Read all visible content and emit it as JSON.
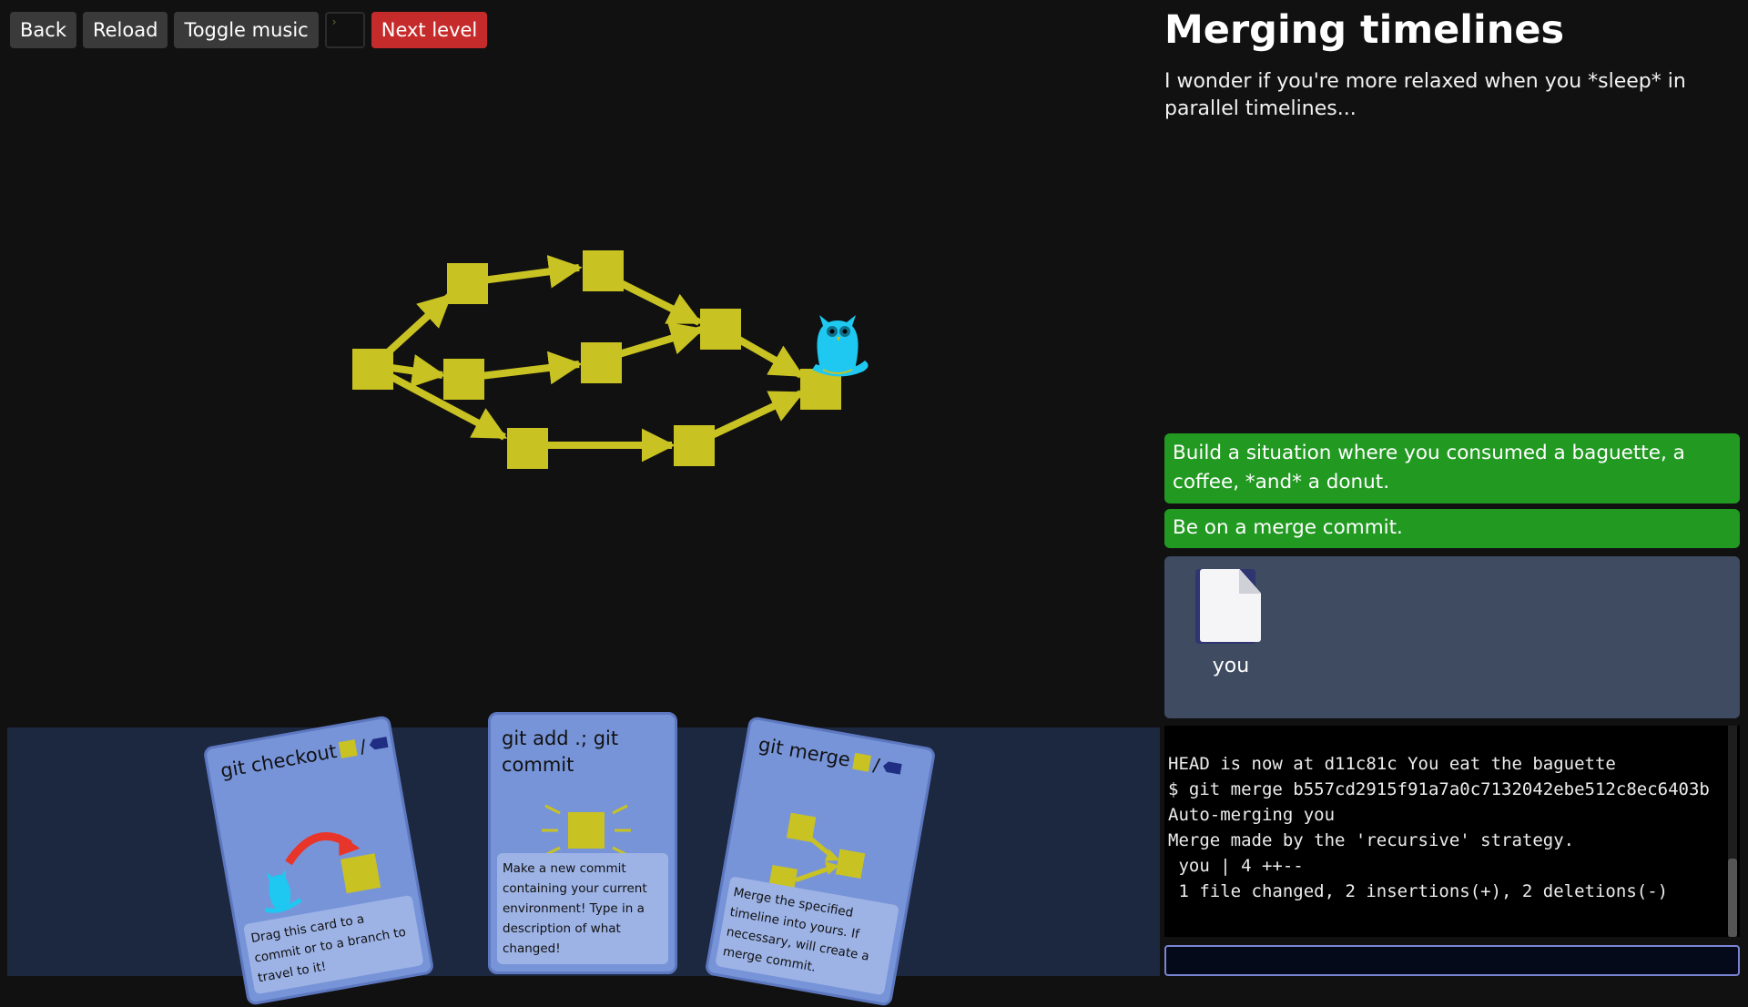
{
  "toolbar": {
    "back_label": "Back",
    "reload_label": "Reload",
    "music_label": "Toggle music",
    "terminal_glyph": "›",
    "next_label": "Next level"
  },
  "level": {
    "title": "Merging timelines",
    "description": "I wonder if you're more relaxed when you *sleep* in parallel timelines..."
  },
  "goals": [
    {
      "text": "Build a situation where you consumed a baguette, a coffee, *and* a donut.",
      "status": "complete"
    },
    {
      "text": "Be on a merge commit.",
      "status": "complete"
    }
  ],
  "files": [
    {
      "name": "you",
      "icon": "file-icon"
    }
  ],
  "terminal": {
    "lines": [
      "HEAD is now at d11c81c You eat the baguette",
      "$ git merge b557cd2915f91a7a0c7132042ebe512c8ec6403b",
      "Auto-merging you",
      "Merge made by the 'recursive' strategy.",
      " you | 4 ++--",
      " 1 file changed, 2 insertions(+), 2 deletions(-)"
    ],
    "input_value": ""
  },
  "cards": {
    "checkout": {
      "title": "git checkout",
      "description": "Drag this card to a commit or to a branch to travel to it!"
    },
    "commit": {
      "title": "git add .; git commit",
      "description": "Make a new commit containing your current environment! Type in a description of what changed!"
    },
    "merge": {
      "title": "git merge",
      "description": "Merge the specified timeline into yours. If necessary, will create a merge commit."
    }
  },
  "graph": {
    "commit_color": "#c9c223",
    "head_character": "owl-icon",
    "head_color": "#1ec8f0",
    "commit_count": 10
  },
  "colors": {
    "background": "#111111",
    "goal_complete": "#229a22",
    "next_button": "#c62b2b",
    "card": "#7794d8",
    "card_area": "#1c2740"
  }
}
